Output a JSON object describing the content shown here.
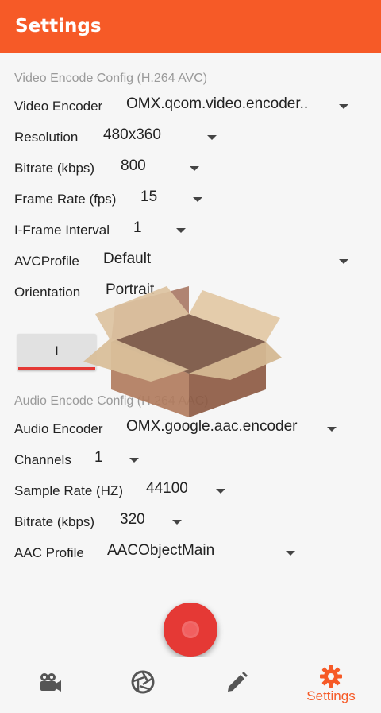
{
  "appbar": {
    "title": "Settings",
    "color": "#f65a27"
  },
  "video": {
    "header": "Video Encode Config (H.264 AVC)",
    "rows": [
      {
        "label": "Video Encoder",
        "value": "OMX.qcom.video.encoder.."
      },
      {
        "label": "Resolution",
        "value": "480x360"
      },
      {
        "label": "Bitrate (kbps)",
        "value": "800"
      },
      {
        "label": "Frame Rate (fps)",
        "value": "15"
      },
      {
        "label": "I-Frame Interval",
        "value": "1"
      },
      {
        "label": "AVCProfile",
        "value": "Default"
      },
      {
        "label": "Orientation",
        "value": "Portrait"
      }
    ],
    "button_label": "I"
  },
  "audio": {
    "header": "Audio Encode Config (H.264 AAC)",
    "rows": [
      {
        "label": "Audio Encoder",
        "value": "OMX.google.aac.encoder"
      },
      {
        "label": "Channels",
        "value": "1"
      },
      {
        "label": "Sample Rate (HZ)",
        "value": "44100"
      },
      {
        "label": "Bitrate (kbps)",
        "value": "320"
      },
      {
        "label": "AAC Profile",
        "value": "AACObjectMain"
      }
    ]
  },
  "fab": {
    "icon": "record-icon",
    "color": "#e53935"
  },
  "bottom_nav": {
    "items": [
      {
        "icon": "video-camera-icon"
      },
      {
        "icon": "camera-aperture-icon"
      },
      {
        "icon": "pencil-icon"
      },
      {
        "icon": "gear-icon",
        "label": "Settings",
        "active": true
      }
    ]
  },
  "overlay": {
    "icon": "open-box-icon"
  }
}
